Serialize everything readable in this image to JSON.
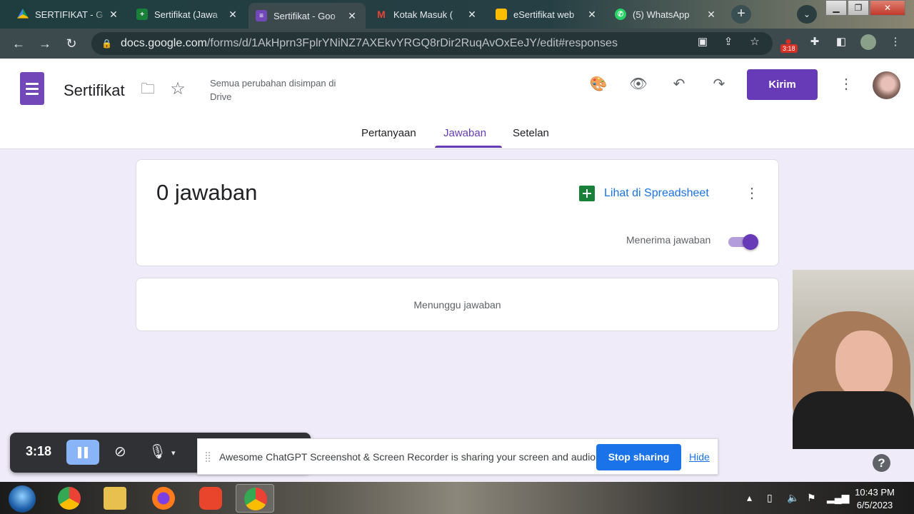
{
  "browser": {
    "tabs": [
      {
        "title": "SERTIFIKAT - G",
        "icon": "drive-icon",
        "color": "#fbbc04"
      },
      {
        "title": "Sertifikat (Jawa",
        "icon": "sheets-icon",
        "color": "#188038"
      },
      {
        "title": "Sertifikat - Goo",
        "icon": "forms-icon",
        "color": "#7248b9"
      },
      {
        "title": "Kotak Masuk (",
        "icon": "gmail-icon",
        "color": "#ea4335"
      },
      {
        "title": "eSertifikat web",
        "icon": "slides-icon",
        "color": "#fbbc04"
      },
      {
        "title": "(5) WhatsApp",
        "icon": "whatsapp-icon",
        "color": "#25d366"
      }
    ],
    "url_host": "docs.google.com",
    "url_path": "/forms/d/1AkHprn3FplrYNiNZ7AXEkvYRGQ8rDir2RuqAvOxEeJY/edit#responses",
    "ext_badge": "3:18"
  },
  "form": {
    "title": "Sertifikat",
    "save_status": "Semua perubahan disimpan di Drive",
    "send_label": "Kirim",
    "tabs": [
      "Pertanyaan",
      "Jawaban",
      "Setelan"
    ],
    "active_tab": "Jawaban",
    "accent": "#673ab7"
  },
  "responses": {
    "count_label": "0 jawaban",
    "sheet_link": "Lihat di Spreadsheet",
    "accepting_label": "Menerima jawaban",
    "accepting": true,
    "waiting_label": "Menunggu jawaban"
  },
  "recorder": {
    "time": "3:18",
    "share_text": "Awesome ChatGPT Screenshot & Screen Recorder is sharing your screen and audio.",
    "stop_label": "Stop sharing",
    "hide_label": "Hide"
  },
  "help": "?",
  "taskbar": {
    "time": "10:43 PM",
    "date": "6/5/2023"
  }
}
